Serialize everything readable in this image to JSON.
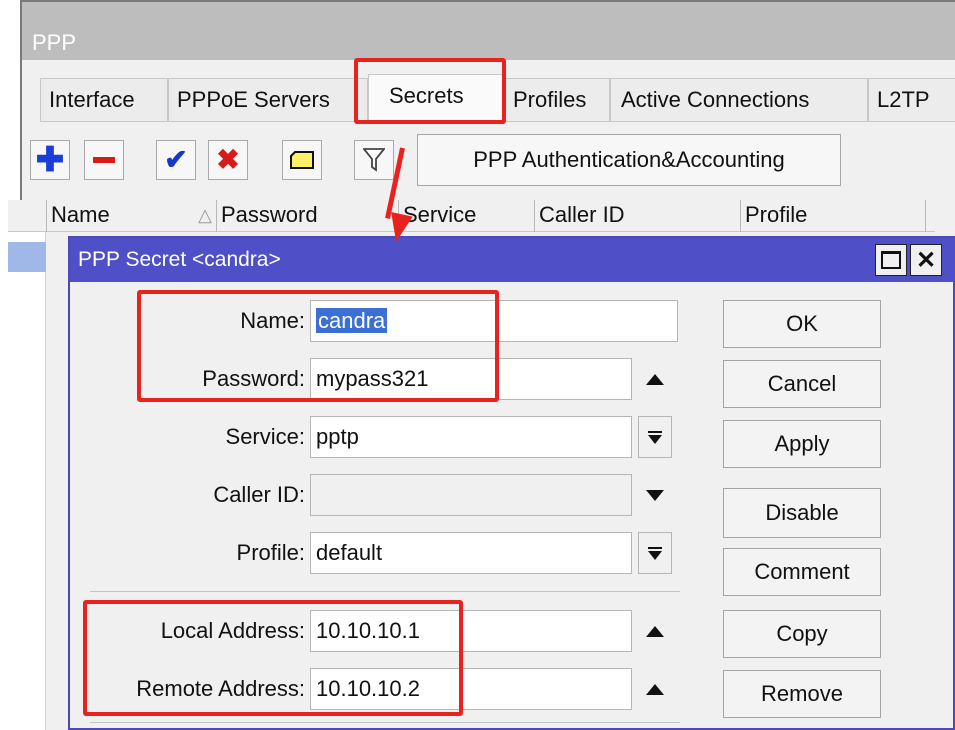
{
  "window": {
    "title": "PPP"
  },
  "tabs": [
    {
      "label": "Interface"
    },
    {
      "label": "PPPoE Servers"
    },
    {
      "label": "Secrets"
    },
    {
      "label": "Profiles"
    },
    {
      "label": "Active Connections"
    },
    {
      "label": "L2TP"
    }
  ],
  "toolbar": {
    "icons": [
      "add-icon",
      "remove-icon",
      "enable-icon",
      "disable-icon",
      "comment-icon",
      "filter-icon"
    ],
    "auth_button_label": "PPP Authentication&Accounting"
  },
  "list": {
    "columns": [
      "Name",
      "Password",
      "Service",
      "Caller ID",
      "Profile"
    ]
  },
  "dialog": {
    "title": "PPP Secret <candra>",
    "fields": {
      "name": {
        "label": "Name:",
        "value": "candra"
      },
      "password": {
        "label": "Password:",
        "value": "mypass321"
      },
      "service": {
        "label": "Service:",
        "value": "pptp"
      },
      "caller_id": {
        "label": "Caller ID:",
        "value": ""
      },
      "profile": {
        "label": "Profile:",
        "value": "default"
      },
      "local_address": {
        "label": "Local Address:",
        "value": "10.10.10.1"
      },
      "remote_address": {
        "label": "Remote Address:",
        "value": "10.10.10.2"
      }
    },
    "buttons": {
      "ok": "OK",
      "cancel": "Cancel",
      "apply": "Apply",
      "disable": "Disable",
      "comment": "Comment",
      "copy": "Copy",
      "remove": "Remove"
    }
  },
  "colors": {
    "dialog_title_bar": "#4f4fc8",
    "highlight_annotation": "#e8231f",
    "selection": "#3b6fd4"
  }
}
